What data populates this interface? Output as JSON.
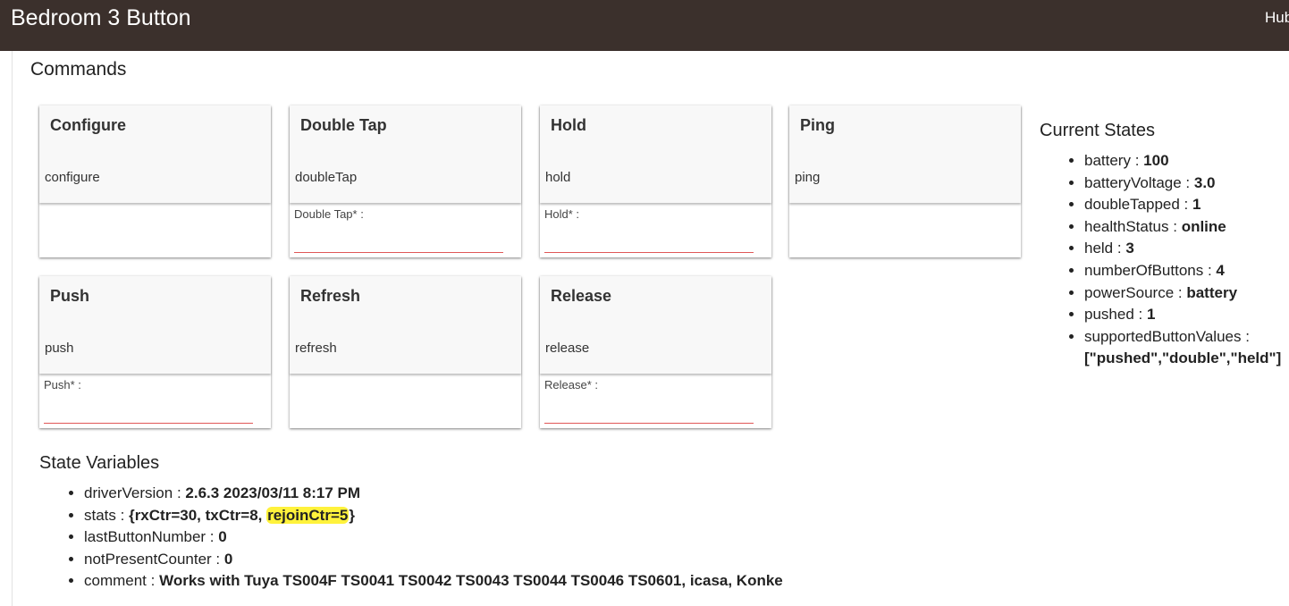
{
  "header": {
    "title": "Bedroom 3 Button",
    "right_label": "Hub"
  },
  "commands": {
    "heading": "Commands",
    "cards": [
      {
        "title": "Configure",
        "command": "configure",
        "param_label": ""
      },
      {
        "title": "Double Tap",
        "command": "doubleTap",
        "param_label": "Double Tap* :",
        "param_value": ""
      },
      {
        "title": "Hold",
        "command": "hold",
        "param_label": "Hold* :",
        "param_value": ""
      },
      {
        "title": "Ping",
        "command": "ping",
        "param_label": ""
      },
      {
        "title": "Push",
        "command": "push",
        "param_label": "Push* :",
        "param_value": ""
      },
      {
        "title": "Refresh",
        "command": "refresh",
        "param_label": ""
      },
      {
        "title": "Release",
        "command": "release",
        "param_label": "Release* :",
        "param_value": ""
      }
    ]
  },
  "current_states": {
    "heading": "Current States",
    "items": [
      {
        "key": "battery",
        "value": "100"
      },
      {
        "key": "batteryVoltage",
        "value": "3.0"
      },
      {
        "key": "doubleTapped",
        "value": "1"
      },
      {
        "key": "healthStatus",
        "value": "online"
      },
      {
        "key": "held",
        "value": "3"
      },
      {
        "key": "numberOfButtons",
        "value": "4"
      },
      {
        "key": "powerSource",
        "value": "battery"
      },
      {
        "key": "pushed",
        "value": "1"
      },
      {
        "key": "supportedButtonValues",
        "value": "[\"pushed\",\"double\",\"held\"]"
      }
    ]
  },
  "state_variables": {
    "heading": "State Variables",
    "items": [
      {
        "key": "driverVersion",
        "value": "2.6.3 2023/03/11 8:17 PM"
      },
      {
        "key": "stats",
        "value": "{rxCtr=30, txCtr=8, ",
        "value_highlight": "rejoinCtr=5",
        "value_tail": "}"
      },
      {
        "key": "lastButtonNumber",
        "value": "0"
      },
      {
        "key": "notPresentCounter",
        "value": "0"
      },
      {
        "key": "comment",
        "value": "Works with Tuya TS004F TS0041 TS0042 TS0043 TS0044 TS0046 TS0601, icasa, Konke"
      }
    ],
    "highlight_color": "#fff23c"
  },
  "colors": {
    "header_bg": "#3b302c",
    "input_underline": "#e05757"
  }
}
